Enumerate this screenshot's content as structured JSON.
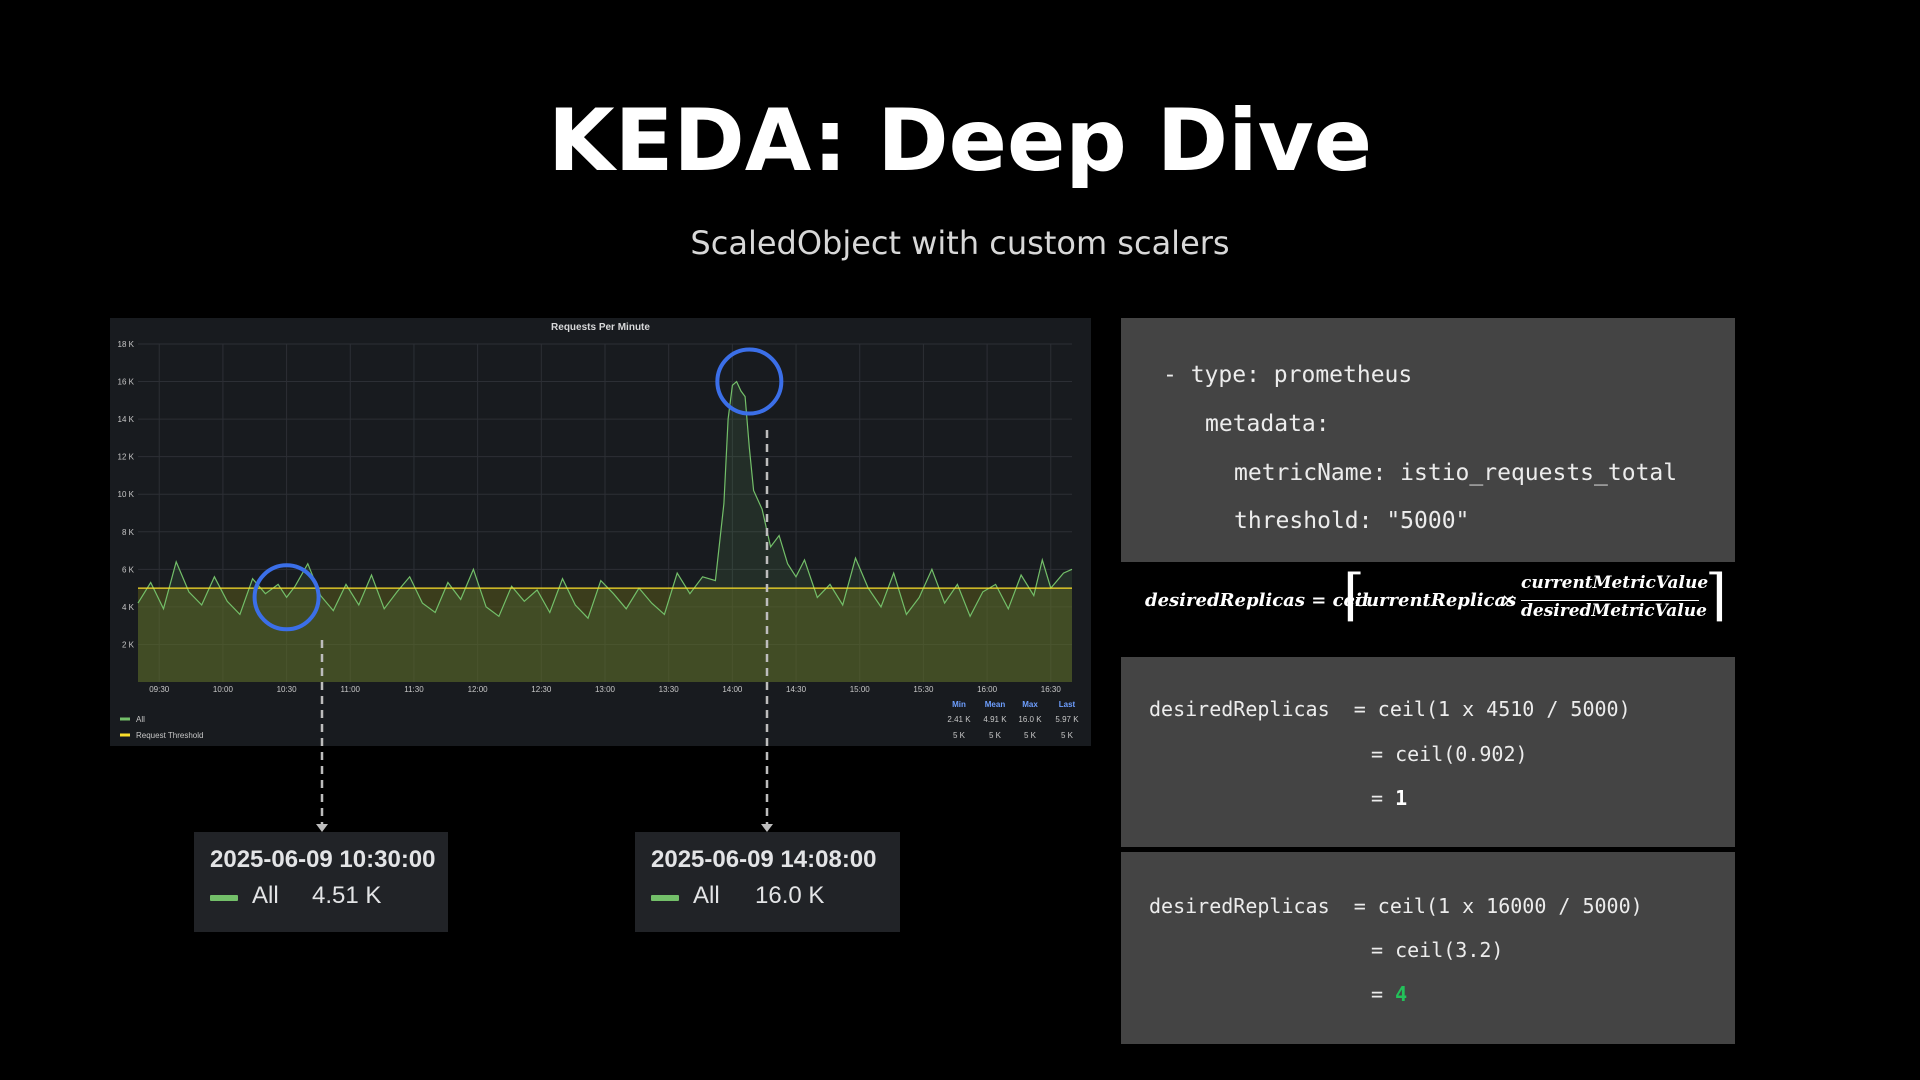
{
  "slide": {
    "title": "KEDA: Deep Dive",
    "subtitle": "ScaledObject with custom scalers"
  },
  "chart_data": {
    "type": "line",
    "title": "Requests Per Minute",
    "ylim": [
      0,
      18000
    ],
    "yticks": [
      "2 K",
      "4 K",
      "6 K",
      "8 K",
      "10 K",
      "12 K",
      "14 K",
      "16 K",
      "18 K"
    ],
    "ytick_values": [
      2000,
      4000,
      6000,
      8000,
      10000,
      12000,
      14000,
      16000,
      18000
    ],
    "xticks": [
      "09:30",
      "10:00",
      "10:30",
      "11:00",
      "11:30",
      "12:00",
      "12:30",
      "13:00",
      "13:30",
      "14:00",
      "14:30",
      "15:00",
      "15:30",
      "16:00",
      "16:30"
    ],
    "xtick_minutes": [
      570,
      600,
      630,
      660,
      690,
      720,
      750,
      780,
      810,
      840,
      870,
      900,
      930,
      960,
      990
    ],
    "xlim_minutes": [
      560,
      1000
    ],
    "grid": true,
    "series": [
      {
        "name": "All",
        "color": "#73bf69",
        "x_minutes": [
          560,
          566,
          572,
          578,
          584,
          590,
          596,
          602,
          608,
          614,
          620,
          626,
          630,
          634,
          640,
          646,
          652,
          658,
          664,
          670,
          676,
          682,
          688,
          694,
          700,
          706,
          712,
          718,
          724,
          730,
          736,
          742,
          748,
          754,
          760,
          766,
          772,
          778,
          784,
          790,
          796,
          802,
          808,
          814,
          820,
          826,
          832,
          836,
          838,
          840,
          842,
          844,
          846,
          848,
          850,
          854,
          858,
          862,
          866,
          870,
          874,
          880,
          886,
          892,
          898,
          904,
          910,
          916,
          922,
          928,
          934,
          940,
          946,
          952,
          958,
          964,
          970,
          976,
          982,
          986,
          990,
          996,
          1000
        ],
        "values": [
          4200,
          5300,
          3900,
          6400,
          4800,
          4100,
          5600,
          4300,
          3600,
          5500,
          4700,
          5200,
          4510,
          5100,
          6300,
          4600,
          3800,
          5200,
          4100,
          5700,
          3900,
          4800,
          5600,
          4200,
          3700,
          5300,
          4400,
          6000,
          4000,
          3500,
          5100,
          4300,
          4900,
          3700,
          5500,
          4100,
          3400,
          5400,
          4700,
          3900,
          5000,
          4200,
          3600,
          5800,
          4700,
          5600,
          5400,
          9500,
          14000,
          15800,
          16000,
          15500,
          15200,
          12500,
          10200,
          9200,
          7200,
          7800,
          6300,
          5600,
          6500,
          4500,
          5200,
          4100,
          6600,
          5000,
          4000,
          5800,
          3600,
          4500,
          6000,
          4200,
          5200,
          3500,
          4800,
          5200,
          3900,
          5700,
          4600,
          6500,
          5000,
          5800,
          6000
        ]
      },
      {
        "name": "Request Threshold",
        "color": "#fade2a",
        "constant": 5000
      }
    ],
    "legend_stats": {
      "headers": [
        "Min",
        "Mean",
        "Max",
        "Last"
      ],
      "rows": [
        [
          "2.41 K",
          "4.91 K",
          "16.0 K",
          "5.97 K"
        ],
        [
          "5 K",
          "5 K",
          "5 K",
          "5 K"
        ]
      ]
    },
    "annotations": [
      {
        "x_minutes": 630,
        "y": 4510,
        "timestamp": "2025-06-09 10:30:00",
        "series": "All",
        "value": "4.51 K"
      },
      {
        "x_minutes": 848,
        "y": 16000,
        "timestamp": "2025-06-09 14:08:00",
        "series": "All",
        "value": "16.0 K"
      }
    ]
  },
  "yaml": {
    "line1": "- type: prometheus",
    "line2": "metadata:",
    "line3": "metricName: istio_requests_total",
    "line4": "threshold: \"5000\""
  },
  "formula": {
    "lhs": "desiredReplicas = ceil",
    "current": "currentReplicas",
    "times": "×",
    "numerator": "currentMetricValue",
    "denominator": "desiredMetricValue"
  },
  "calc1": {
    "line1": "desiredReplicas  = ceil(1 x 4510 / 5000)",
    "line2": "= ceil(0.902)",
    "line3_eq": "= ",
    "line3_val": "1"
  },
  "calc2": {
    "line1": "desiredReplicas  = ceil(1 x 16000 / 5000)",
    "line2": "= ceil(3.2)",
    "line3_eq": "= ",
    "line3_val": "4"
  },
  "colors": {
    "highlight_circle": "#3b6fe8",
    "series_all": "#73bf69",
    "threshold": "#fade2a",
    "result_green": "#23c15a"
  }
}
